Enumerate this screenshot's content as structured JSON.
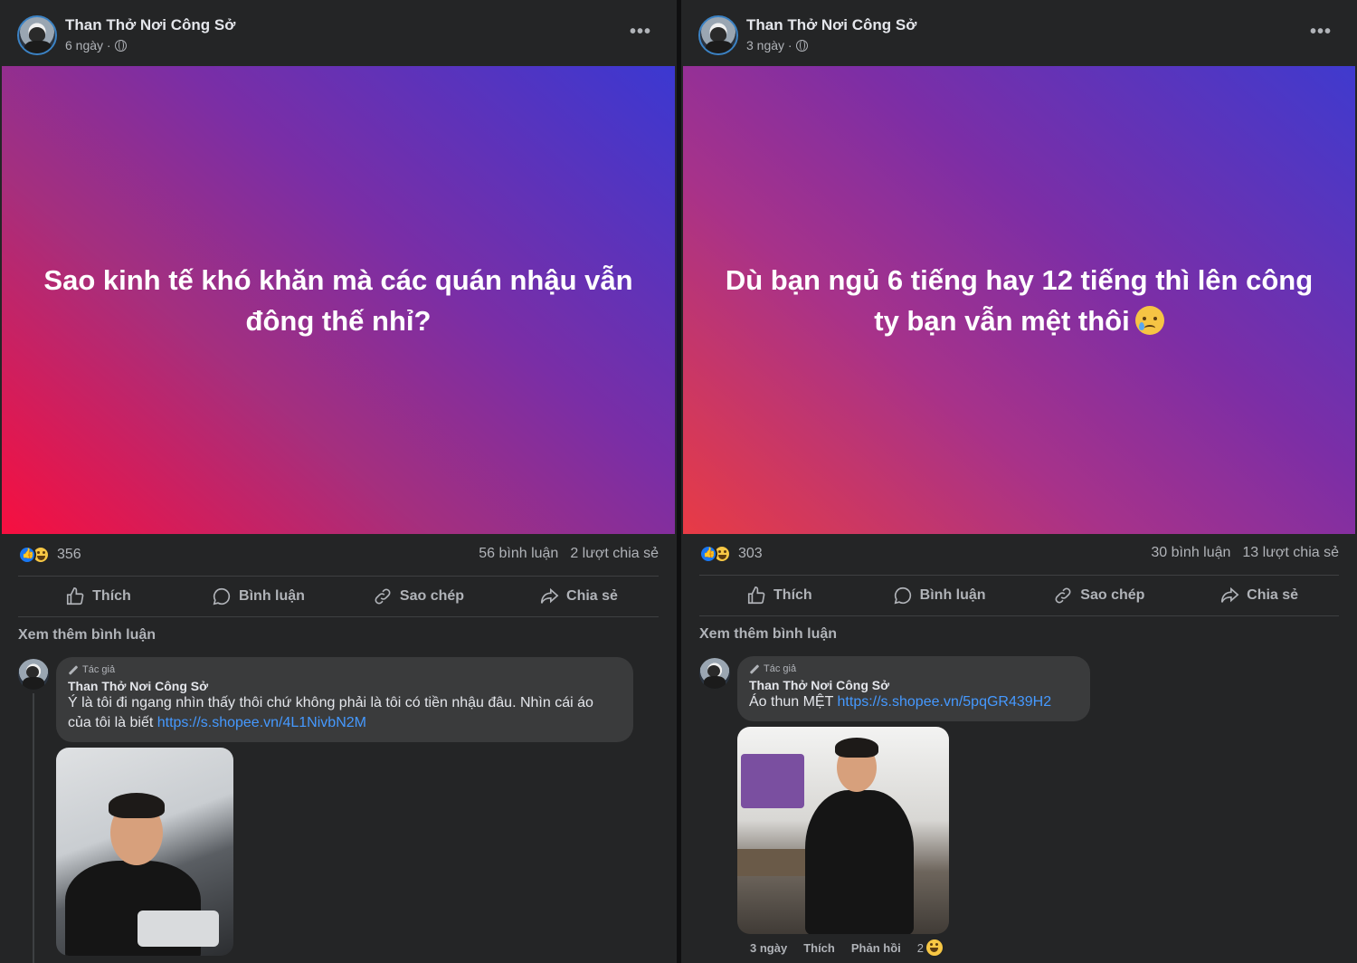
{
  "posts": [
    {
      "page_name": "Than Thở Nơi Công Sở",
      "time": "6 ngày ·",
      "more_label": "•••",
      "banner_text": "Sao kinh tế khó khăn mà các quán nhậu vẫn đông thế nhỉ?",
      "reaction_count": "356",
      "comments_count": "56 bình luận",
      "shares_count": "2 lượt chia sẻ",
      "actions": {
        "like": "Thích",
        "comment": "Bình luận",
        "copy": "Sao chép",
        "share": "Chia sẻ"
      },
      "more_comments": "Xem thêm bình luận",
      "comment": {
        "badge": "Tác giả",
        "author": "Than Thở Nơi Công Sở",
        "text_line1": "Ý là tôi đi ngang nhìn thấy thôi chứ không phải là tôi có tiền nhậu đâu. Nhìn cái áo",
        "text_line2": "của tôi là biết ",
        "link": "https://s.shopee.vn/4L1NivbN2M"
      }
    },
    {
      "page_name": "Than Thở Nơi Công Sở",
      "time": "3 ngày ·",
      "more_label": "•••",
      "banner_text": "Dù bạn ngủ 6 tiếng hay 12 tiếng thì lên công ty bạn vẫn mệt thôi",
      "reaction_count": "303",
      "comments_count": "30 bình luận",
      "shares_count": "13 lượt chia sẻ",
      "actions": {
        "like": "Thích",
        "comment": "Bình luận",
        "copy": "Sao chép",
        "share": "Chia sẻ"
      },
      "more_comments": "Xem thêm bình luận",
      "comment": {
        "badge": "Tác giả",
        "author": "Than Thở Nơi Công Sở",
        "text_line1": "Áo thun MỆT ",
        "link": "https://s.shopee.vn/5pqGR439H2",
        "footer_time": "3 ngày",
        "footer_like": "Thích",
        "footer_reply": "Phản hồi",
        "footer_reactions": "2"
      }
    }
  ]
}
